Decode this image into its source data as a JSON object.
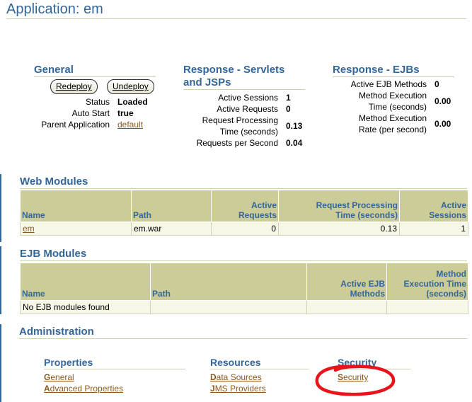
{
  "page": {
    "title": "Application: em"
  },
  "general": {
    "heading": "General",
    "redeploy_label": "Redeploy",
    "undeploy_label": "Undeploy",
    "status_label": "Status",
    "status_value": "Loaded",
    "autostart_label": "Auto Start",
    "autostart_value": "true",
    "parent_label": "Parent Application",
    "parent_value": "default"
  },
  "response_servlets": {
    "heading_line1": "Response - Servlets",
    "heading_line2": "and JSPs",
    "active_sessions_label": "Active Sessions",
    "active_sessions_value": "1",
    "active_requests_label": "Active Requests",
    "active_requests_value": "0",
    "rpt_label_line1": "Request Processing",
    "rpt_label_line2": "Time (seconds)",
    "rpt_value": "0.13",
    "rps_label": "Requests per Second",
    "rps_value": "0.04"
  },
  "response_ejbs": {
    "heading": "Response - EJBs",
    "active_methods_label": "Active EJB Methods",
    "active_methods_value": "0",
    "met_label_line1": "Method Execution",
    "met_label_line2": "Time (seconds)",
    "met_value": "0.00",
    "mer_label_line1": "Method Execution",
    "mer_label_line2": "Rate (per second)",
    "mer_value": "0.00"
  },
  "web_modules": {
    "heading": "Web Modules",
    "columns": {
      "name": "Name",
      "path": "Path",
      "active_requests_1": "Active",
      "active_requests_2": "Requests",
      "rpt_1": "Request Processing",
      "rpt_2": "Time (seconds)",
      "active_sessions_1": "Active",
      "active_sessions_2": "Sessions"
    },
    "rows": [
      {
        "name": "em",
        "path": "em.war",
        "active_requests": "0",
        "rpt": "0.13",
        "active_sessions": "1"
      }
    ]
  },
  "ejb_modules": {
    "heading": "EJB Modules",
    "columns": {
      "name": "Name",
      "path": "Path",
      "active_methods_1": "Active EJB",
      "active_methods_2": "Methods",
      "met_1": "Method",
      "met_2": "Execution Time",
      "met_3": "(seconds)"
    },
    "empty_message": "No EJB modules found"
  },
  "administration": {
    "heading": "Administration",
    "properties": {
      "heading": "Properties",
      "general_first": "G",
      "general_rest": "eneral",
      "advanced_first": "A",
      "advanced_rest": "dvanced Properties"
    },
    "resources": {
      "heading": "Resources",
      "datasources_first": "D",
      "datasources_rest": "ata Sources",
      "jms_first": "J",
      "jms_rest": "MS Providers"
    },
    "security": {
      "heading": "Security",
      "link_first": "S",
      "link_rest": "ecurity",
      "highlight_color": "#e8141b"
    }
  },
  "colors": {
    "accent": "#336699",
    "table_header": "#cccc99",
    "table_row": "#f7f7e7",
    "link": "#8b5a1e"
  }
}
